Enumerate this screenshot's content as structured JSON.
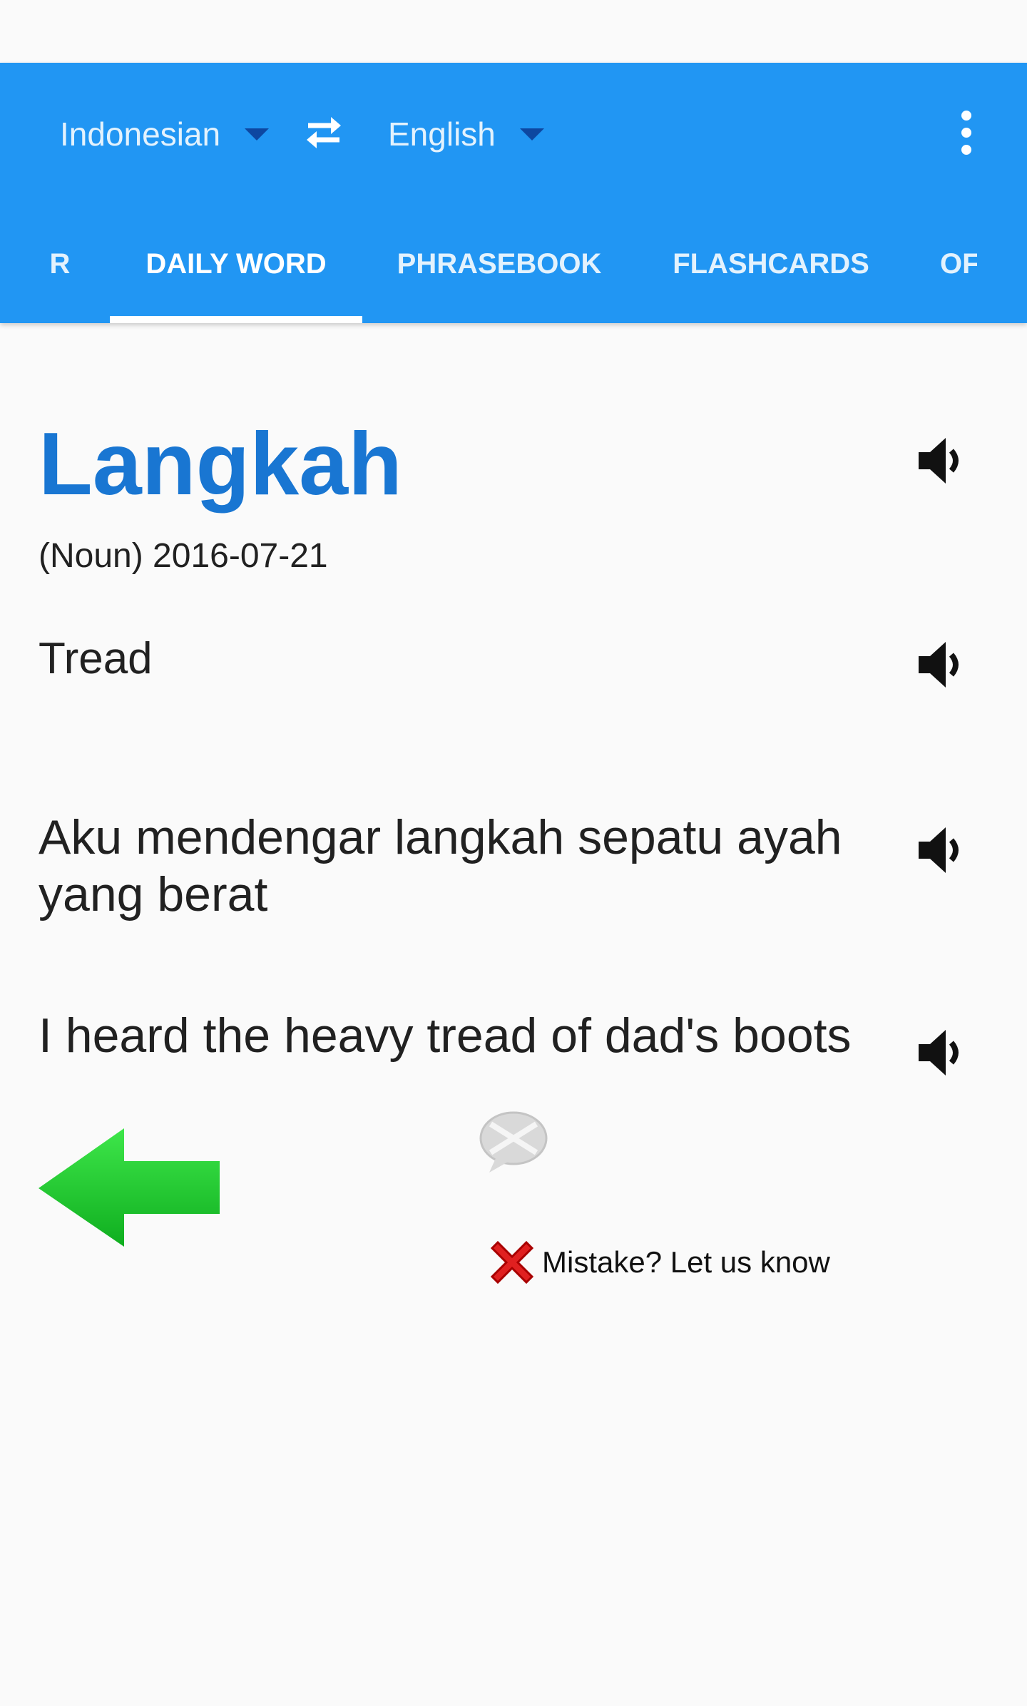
{
  "header": {
    "source_language": "Indonesian",
    "target_language": "English"
  },
  "tabs": [
    {
      "label": "R"
    },
    {
      "label": "DAILY WORD",
      "selected": true
    },
    {
      "label": "PHRASEBOOK"
    },
    {
      "label": "FLASHCARDS"
    },
    {
      "label": "OF"
    }
  ],
  "word": {
    "title": "Langkah",
    "meta": "(Noun) 2016-07-21",
    "translation": "Tread",
    "example_source": "Aku mendengar langkah sepatu ayah yang berat",
    "example_target": "I heard the heavy tread of dad's boots"
  },
  "feedback": {
    "mistake_label": "Mistake? Let us know"
  },
  "colors": {
    "appbar": "#2196f3",
    "title": "#1976d2",
    "arrow": "#22cc33"
  },
  "icons": [
    "caret-down-icon",
    "swap-icon",
    "more-vert-icon",
    "speaker-icon",
    "back-arrow-icon",
    "chat-bubble-icon",
    "red-x-icon"
  ]
}
